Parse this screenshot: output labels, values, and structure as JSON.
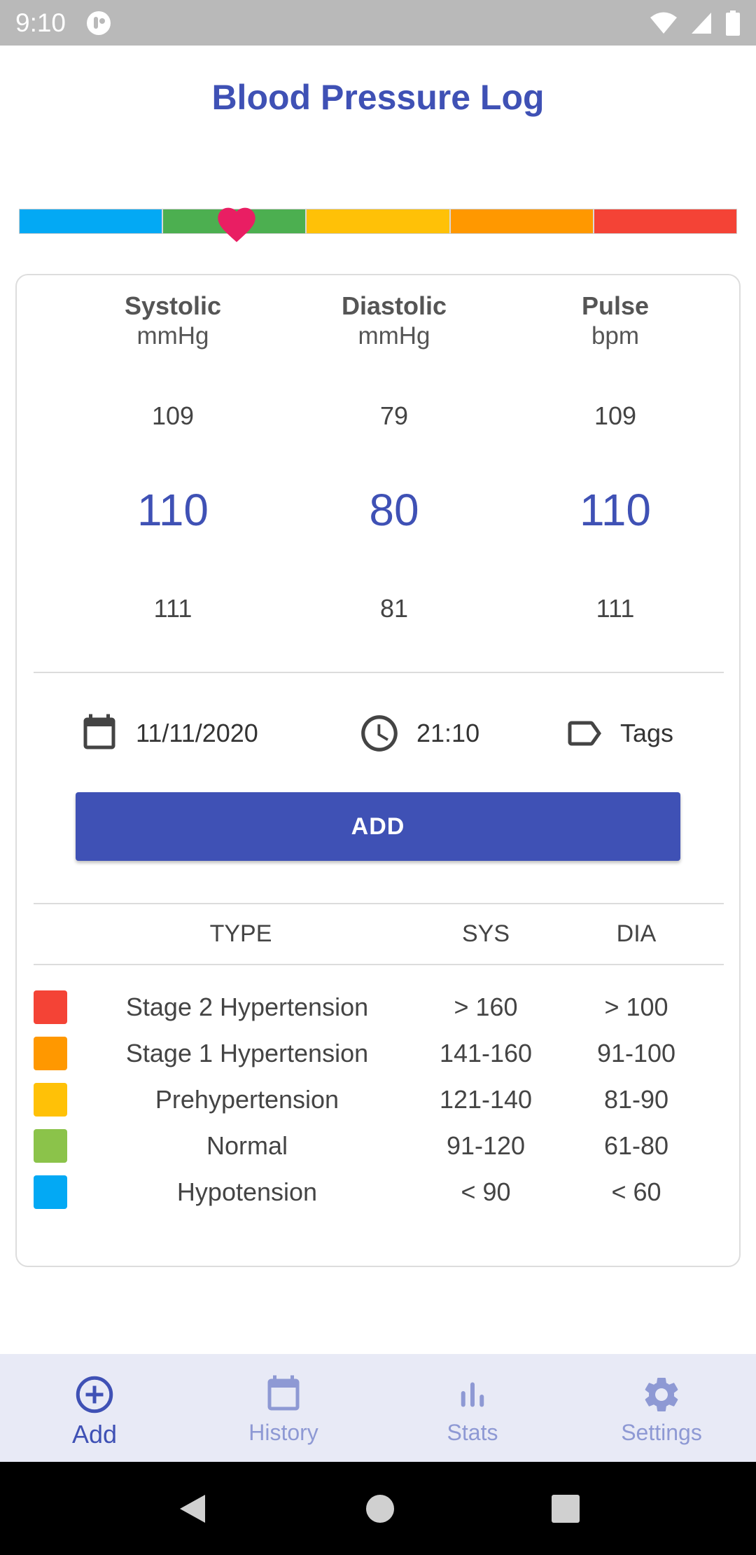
{
  "status_bar": {
    "time": "9:10"
  },
  "app_title": "Blood Pressure Log",
  "scale_colors": [
    "#03a9f4",
    "#4caf50",
    "#ffc107",
    "#ff9800",
    "#f44336"
  ],
  "scale_heart_color": "#e91e63",
  "columns": [
    {
      "name": "Systolic",
      "unit": "mmHg",
      "prev": "109",
      "current": "110",
      "next": "111"
    },
    {
      "name": "Diastolic",
      "unit": "mmHg",
      "prev": "79",
      "current": "80",
      "next": "81"
    },
    {
      "name": "Pulse",
      "unit": "bpm",
      "prev": "109",
      "current": "110",
      "next": "111"
    }
  ],
  "meta": {
    "date": "11/11/2020",
    "time": "21:10",
    "tags_label": "Tags"
  },
  "add_button_label": "ADD",
  "table": {
    "headers": {
      "type": "TYPE",
      "sys": "SYS",
      "dia": "DIA"
    },
    "rows": [
      {
        "color": "#f44336",
        "type": "Stage 2 Hypertension",
        "sys": "> 160",
        "dia": "> 100"
      },
      {
        "color": "#ff9800",
        "type": "Stage 1 Hypertension",
        "sys": "141-160",
        "dia": "91-100"
      },
      {
        "color": "#ffc107",
        "type": "Prehypertension",
        "sys": "121-140",
        "dia": "81-90"
      },
      {
        "color": "#8bc34a",
        "type": "Normal",
        "sys": "91-120",
        "dia": "61-80"
      },
      {
        "color": "#03a9f4",
        "type": "Hypotension",
        "sys": "< 90",
        "dia": "< 60"
      }
    ]
  },
  "bottom_nav": [
    {
      "label": "Add",
      "icon": "add-circle-icon",
      "active": true
    },
    {
      "label": "History",
      "icon": "calendar-icon",
      "active": false
    },
    {
      "label": "Stats",
      "icon": "bar-chart-icon",
      "active": false
    },
    {
      "label": "Settings",
      "icon": "gear-icon",
      "active": false
    }
  ]
}
